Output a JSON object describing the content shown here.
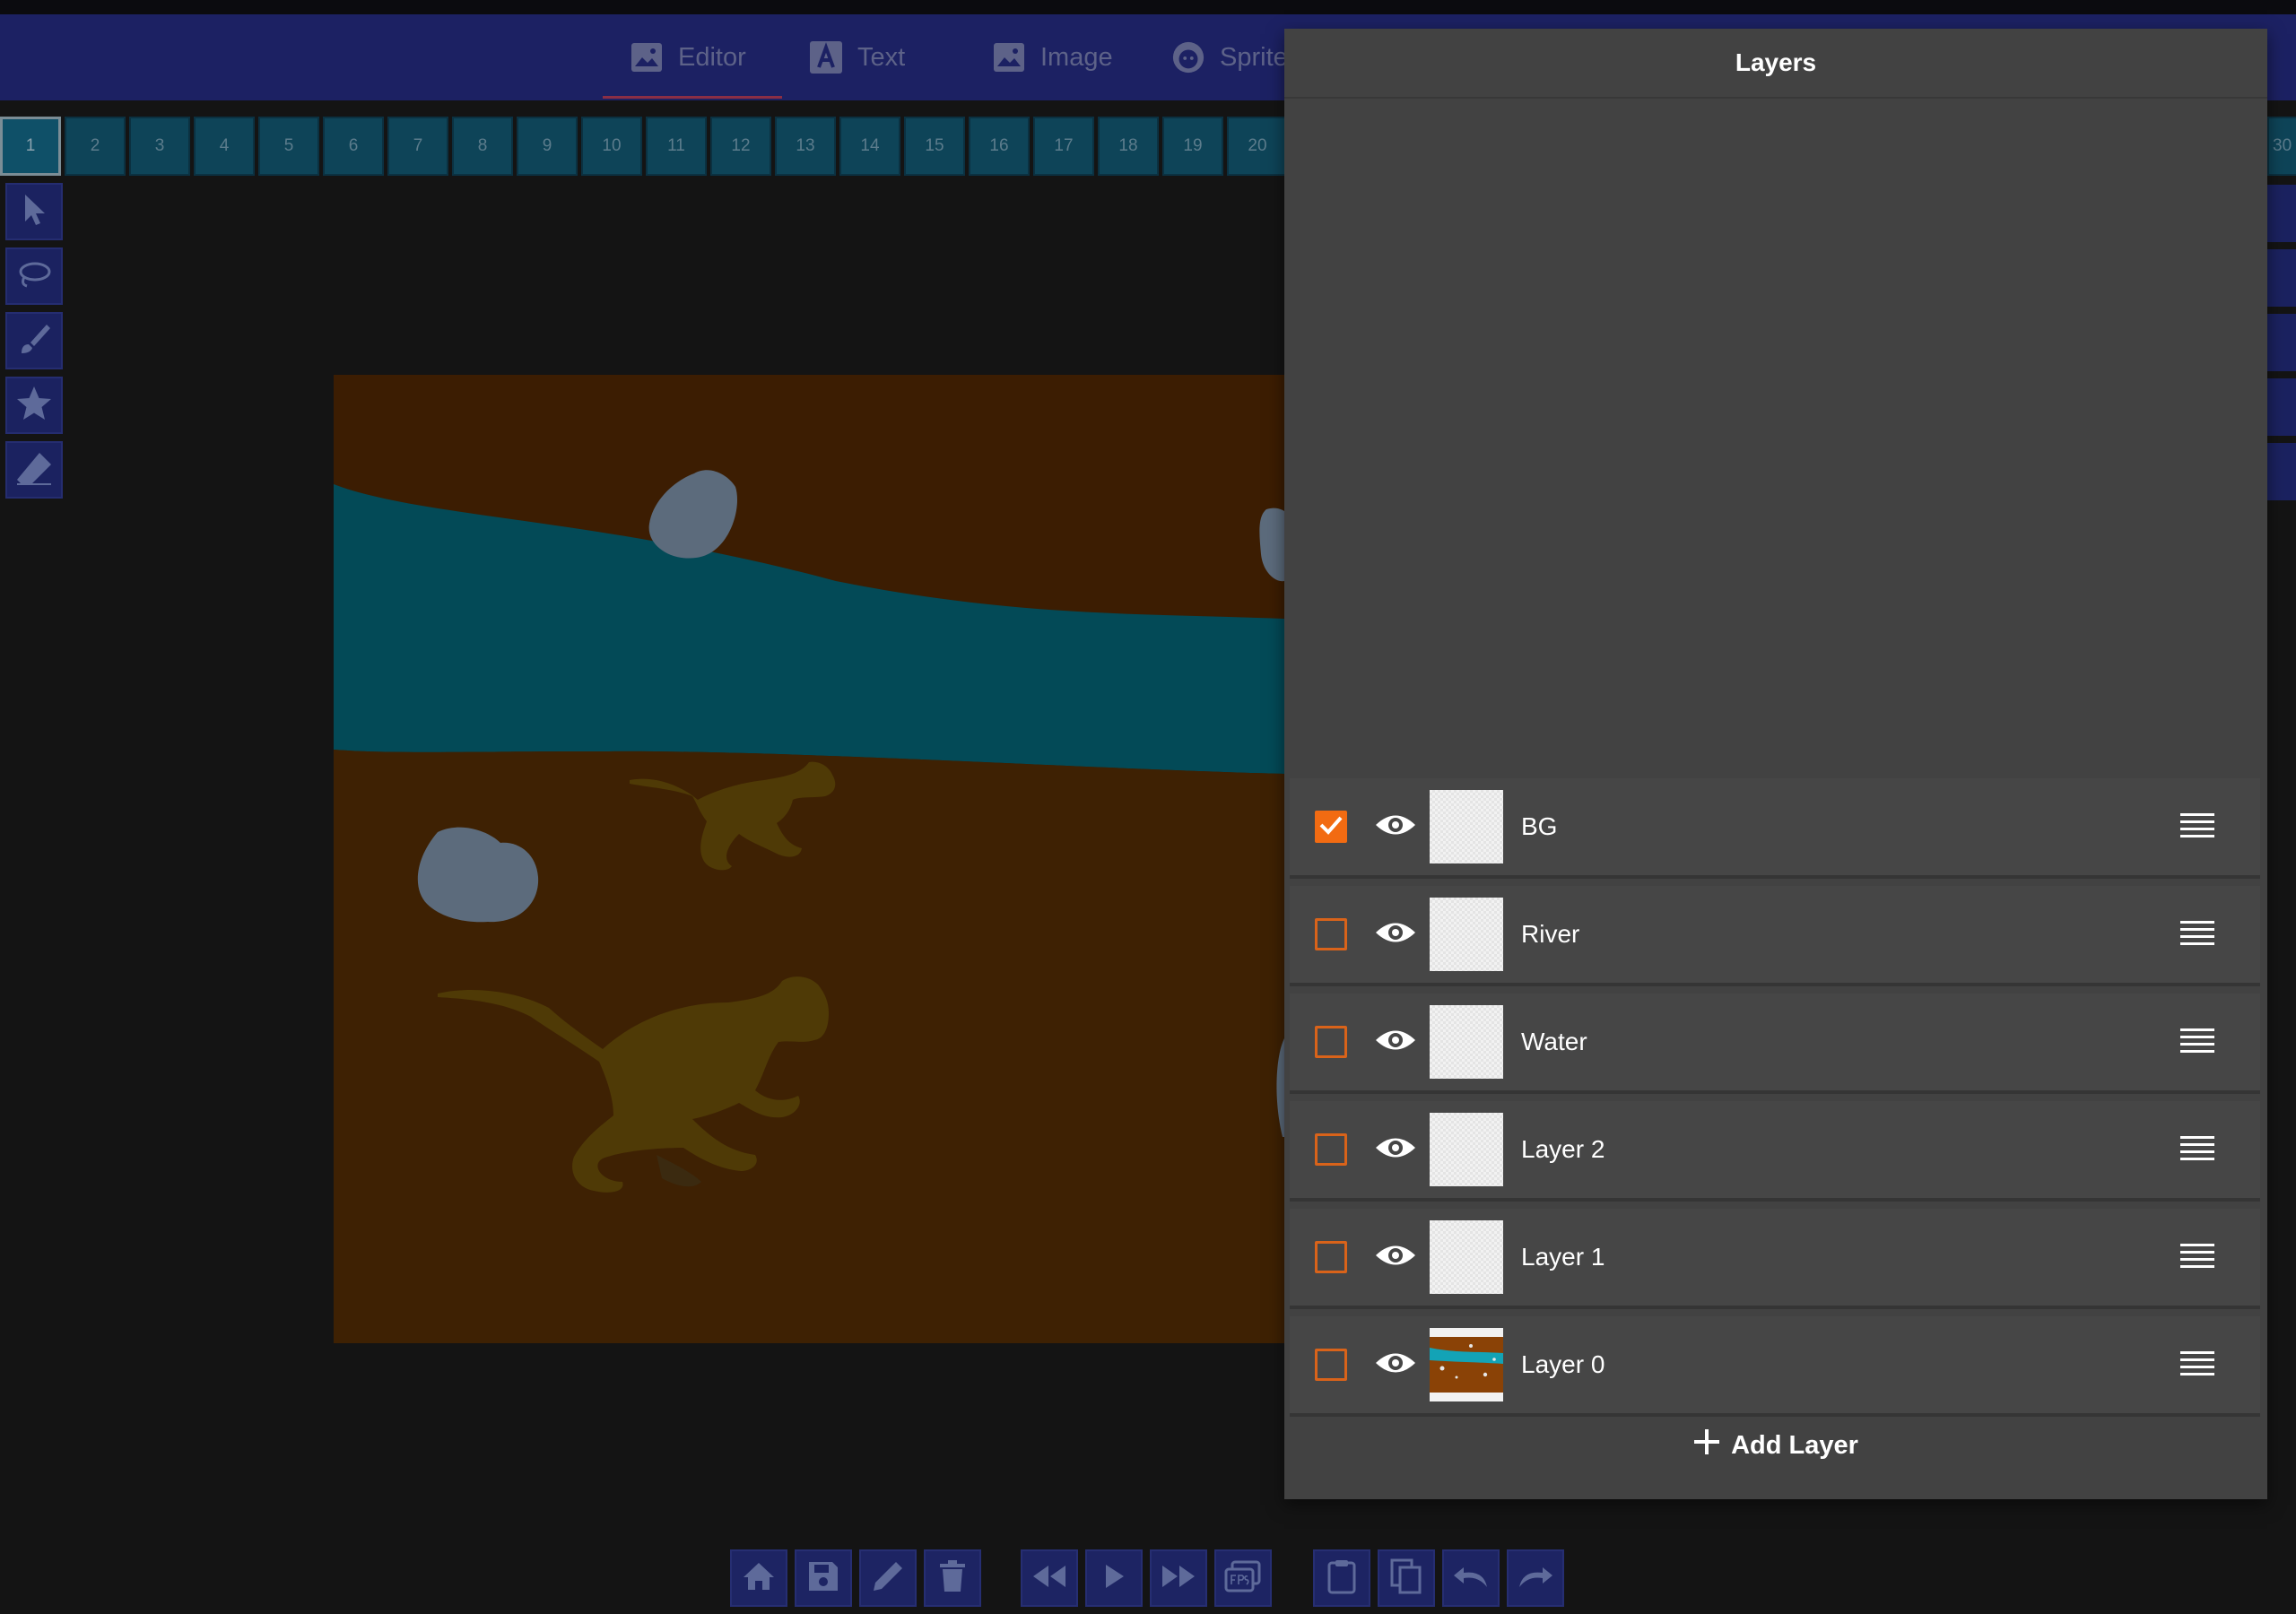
{
  "header": {
    "tabs": [
      {
        "label": "Editor",
        "icon": "image-icon",
        "active": true
      },
      {
        "label": "Text",
        "icon": "text-icon",
        "active": false
      },
      {
        "label": "Image",
        "icon": "image-icon",
        "active": false
      },
      {
        "label": "Sprite",
        "icon": "sprite-face-icon",
        "active": false
      }
    ]
  },
  "frames": {
    "selected": 1,
    "labels": [
      "1",
      "2",
      "3",
      "4",
      "5",
      "6",
      "7",
      "8",
      "9",
      "10",
      "11",
      "12",
      "13",
      "14",
      "15",
      "16",
      "17",
      "18",
      "19",
      "20"
    ],
    "peek_label": "30"
  },
  "tools": [
    {
      "name": "select-arrow-icon"
    },
    {
      "name": "lasso-icon"
    },
    {
      "name": "brush-icon"
    },
    {
      "name": "star-shape-icon"
    },
    {
      "name": "eraser-icon"
    }
  ],
  "layers_panel": {
    "title": "Layers",
    "layers": [
      {
        "name": "BG",
        "checked": true,
        "visible": true
      },
      {
        "name": "River",
        "checked": false,
        "visible": true
      },
      {
        "name": "Water",
        "checked": false,
        "visible": true
      },
      {
        "name": "Layer 2",
        "checked": false,
        "visible": true
      },
      {
        "name": "Layer 1",
        "checked": false,
        "visible": true
      },
      {
        "name": "Layer 0",
        "checked": false,
        "visible": true
      }
    ],
    "add_layer_label": "Add Layer"
  },
  "bottom_toolbar": [
    "home-icon",
    "save-icon",
    "pencil-icon",
    "trash-icon",
    "rewind-icon",
    "play-icon",
    "fast-forward-icon",
    "fps-icon",
    "clipboard-icon",
    "copy-icon",
    "undo-icon",
    "redo-icon"
  ],
  "colors": {
    "header_bg": "#1c2163",
    "panel_bg": "#424242",
    "accent_orange": "#f26b12",
    "frame_bg": "#0e4458"
  }
}
